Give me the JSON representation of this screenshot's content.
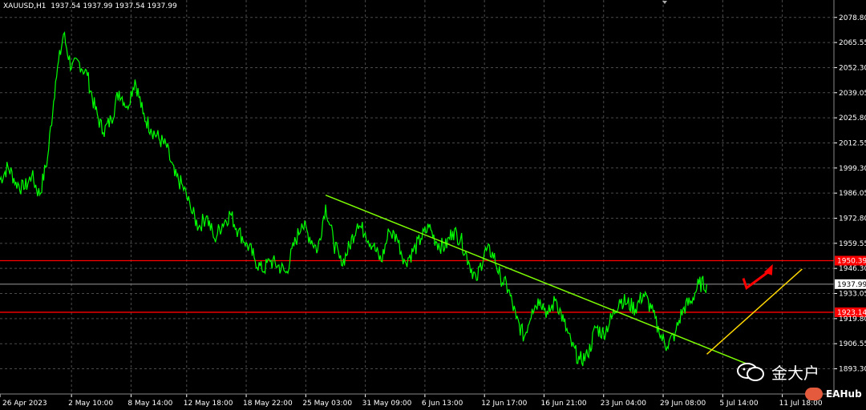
{
  "header": {
    "symbol_timeframe": "XAUUSD,H1",
    "ohlc": "1937.54 1937.99 1937.54 1937.99"
  },
  "watermark": {
    "text": "金大户",
    "brand": "EAHub"
  },
  "colors": {
    "background": "#000000",
    "price_line": "#00ff00",
    "trendline_down": "#7cfc00",
    "trendline_up": "#ffd700",
    "level_lines": "#ff0000",
    "arrow": "#ff0000",
    "grid": "#4a4a4a",
    "axis_text": "#ffffff"
  },
  "chart_data": {
    "type": "line",
    "title": "XAUUSD,H1",
    "ylim": [
      1880.0,
      2088.0
    ],
    "grid": true,
    "y_ticks": [
      "2078.80",
      "2065.55",
      "2052.30",
      "2039.05",
      "2025.80",
      "2012.55",
      "1999.30",
      "1986.05",
      "1972.80",
      "1959.55",
      "1946.30",
      "1933.05",
      "1919.80",
      "1906.55",
      "1893.30"
    ],
    "x_tick_labels": [
      "26 Apr 2023",
      "2 May 10:00",
      "8 May 14:00",
      "12 May 18:00",
      "18 May 22:00",
      "25 May 03:00",
      "31 May 09:00",
      "6 Jun 13:00",
      "12 Jun 17:00",
      "16 Jun 21:00",
      "23 Jun 04:00",
      "29 Jun 08:00",
      "5 Jul 14:00",
      "11 Jul 18:00"
    ],
    "series": [
      {
        "values": [
          [
            0,
            1993
          ],
          [
            1,
            2000
          ],
          [
            2,
            1992
          ],
          [
            3,
            1988
          ],
          [
            4,
            1995
          ],
          [
            5,
            1985
          ],
          [
            6,
            2005
          ],
          [
            7,
            2045
          ],
          [
            8,
            2070
          ],
          [
            9,
            2052
          ],
          [
            10,
            2055
          ],
          [
            11,
            2048
          ],
          [
            12,
            2030
          ],
          [
            13,
            2018
          ],
          [
            14,
            2025
          ],
          [
            15,
            2040
          ],
          [
            16,
            2032
          ],
          [
            17,
            2046
          ],
          [
            18,
            2028
          ],
          [
            19,
            2020
          ],
          [
            20,
            2015
          ],
          [
            21,
            2010
          ],
          [
            22,
            1995
          ],
          [
            23,
            1990
          ],
          [
            24,
            1978
          ],
          [
            25,
            1968
          ],
          [
            26,
            1974
          ],
          [
            27,
            1962
          ],
          [
            28,
            1970
          ],
          [
            29,
            1975
          ],
          [
            30,
            1966
          ],
          [
            31,
            1960
          ],
          [
            32,
            1952
          ],
          [
            33,
            1945
          ],
          [
            34,
            1950
          ],
          [
            35,
            1948
          ],
          [
            36,
            1944
          ],
          [
            37,
            1958
          ],
          [
            38,
            1970
          ],
          [
            39,
            1963
          ],
          [
            40,
            1956
          ],
          [
            41,
            1980
          ],
          [
            42,
            1960
          ],
          [
            43,
            1948
          ],
          [
            44,
            1958
          ],
          [
            45,
            1970
          ],
          [
            46,
            1965
          ],
          [
            47,
            1958
          ],
          [
            48,
            1950
          ],
          [
            49,
            1966
          ],
          [
            50,
            1962
          ],
          [
            51,
            1950
          ],
          [
            52,
            1955
          ],
          [
            53,
            1962
          ],
          [
            54,
            1968
          ],
          [
            55,
            1960
          ],
          [
            56,
            1957
          ],
          [
            57,
            1966
          ],
          [
            58,
            1962
          ],
          [
            59,
            1950
          ],
          [
            60,
            1940
          ],
          [
            61,
            1955
          ],
          [
            62,
            1955
          ],
          [
            63,
            1942
          ],
          [
            64,
            1935
          ],
          [
            65,
            1920
          ],
          [
            66,
            1910
          ],
          [
            67,
            1925
          ],
          [
            68,
            1930
          ],
          [
            69,
            1922
          ],
          [
            70,
            1930
          ],
          [
            71,
            1918
          ],
          [
            72,
            1905
          ],
          [
            73,
            1898
          ],
          [
            74,
            1900
          ],
          [
            75,
            1915
          ],
          [
            76,
            1912
          ],
          [
            77,
            1920
          ],
          [
            78,
            1930
          ],
          [
            79,
            1928
          ],
          [
            80,
            1925
          ],
          [
            81,
            1933
          ],
          [
            82,
            1925
          ],
          [
            83,
            1912
          ],
          [
            84,
            1905
          ],
          [
            85,
            1912
          ],
          [
            86,
            1925
          ],
          [
            87,
            1929
          ],
          [
            88,
            1938
          ],
          [
            89,
            1937.99
          ]
        ]
      }
    ],
    "price_line": 1937.99,
    "levels": [
      1950.39,
      1923.14
    ],
    "trend_down": [
      [
        41,
        1985
      ],
      [
        94,
        1896
      ]
    ],
    "trend_up": [
      [
        89,
        1901
      ],
      [
        101,
        1946
      ]
    ],
    "arrow": [
      [
        94,
        1936
      ],
      [
        97,
        1946
      ]
    ]
  }
}
